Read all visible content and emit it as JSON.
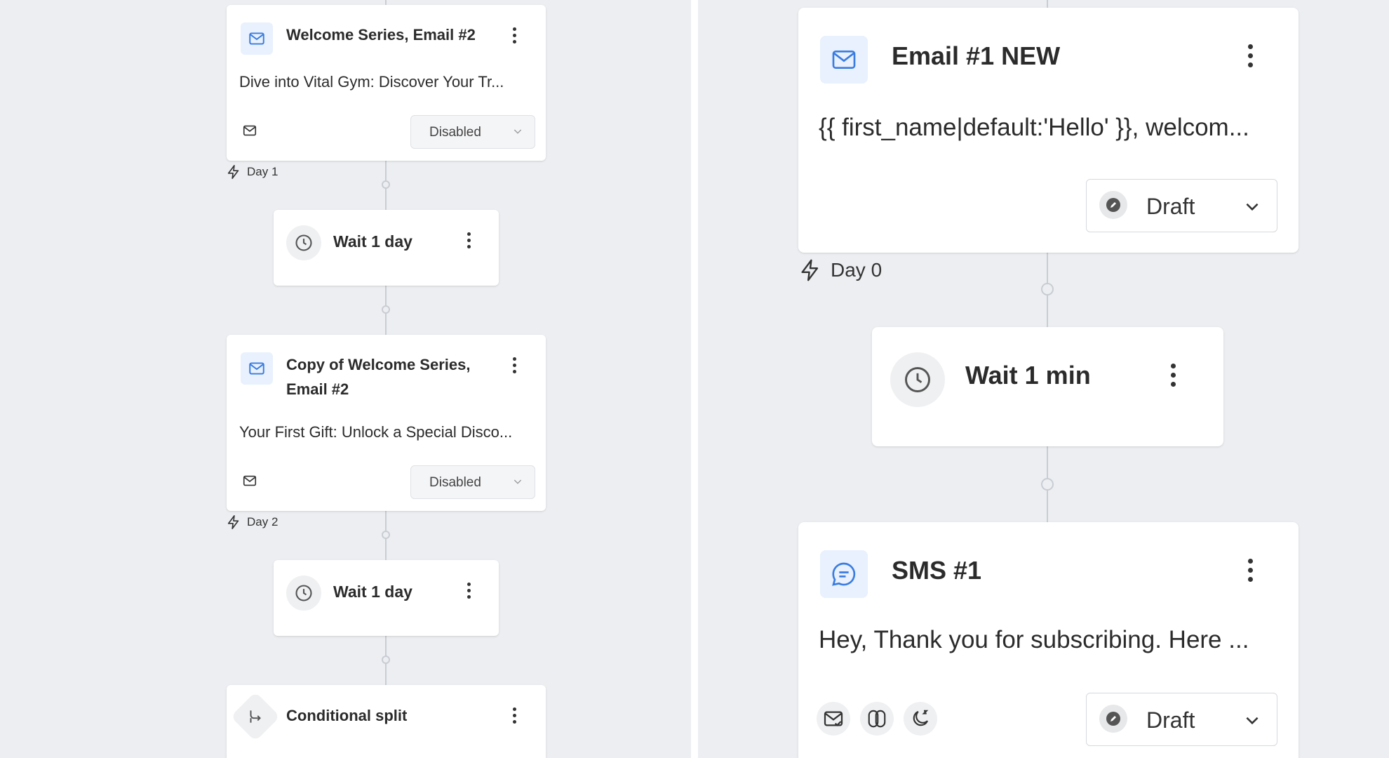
{
  "left_flow": {
    "email_card_1": {
      "title": "Welcome Series, Email #2",
      "preview": "Dive into Vital Gym: Discover Your Tr...",
      "status": "Disabled",
      "icon": "envelope-icon"
    },
    "delay_1": {
      "label": "Day 1",
      "icon": "lightning-icon"
    },
    "wait_1": {
      "label": "Wait 1 day",
      "icon": "clock-icon"
    },
    "email_card_2": {
      "title_line1": "Copy of Welcome Series,",
      "title_line2": "Email #2",
      "preview": "Your First Gift: Unlock a Special Disco...",
      "status": "Disabled",
      "icon": "envelope-icon"
    },
    "delay_2": {
      "label": "Day 2",
      "icon": "lightning-icon"
    },
    "wait_2": {
      "label": "Wait 1 day",
      "icon": "clock-icon"
    },
    "split_card": {
      "title": "Conditional split",
      "icon": "split-icon"
    }
  },
  "right_flow": {
    "email_card": {
      "title": "Email #1 NEW",
      "preview": "{{ first_name|default:'Hello' }}, welcom...",
      "status": "Draft",
      "icon": "envelope-icon"
    },
    "delay": {
      "label": "Day 0",
      "icon": "lightning-icon"
    },
    "wait": {
      "label": "Wait 1 min",
      "icon": "clock-icon"
    },
    "sms_card": {
      "title": "SMS #1",
      "preview": "Hey, Thank you for subscribing. Here ...",
      "status": "Draft",
      "icon": "chat-bubble-icon",
      "badges": [
        "mail-check-icon",
        "utm-link-icon",
        "quiet-hours-moon-icon"
      ]
    }
  },
  "colors": {
    "canvas": "#eceef1",
    "accent_blue": "#3a7ce0",
    "icon_tile_bg": "#e8f1fd",
    "connector": "#c9cdd3"
  }
}
